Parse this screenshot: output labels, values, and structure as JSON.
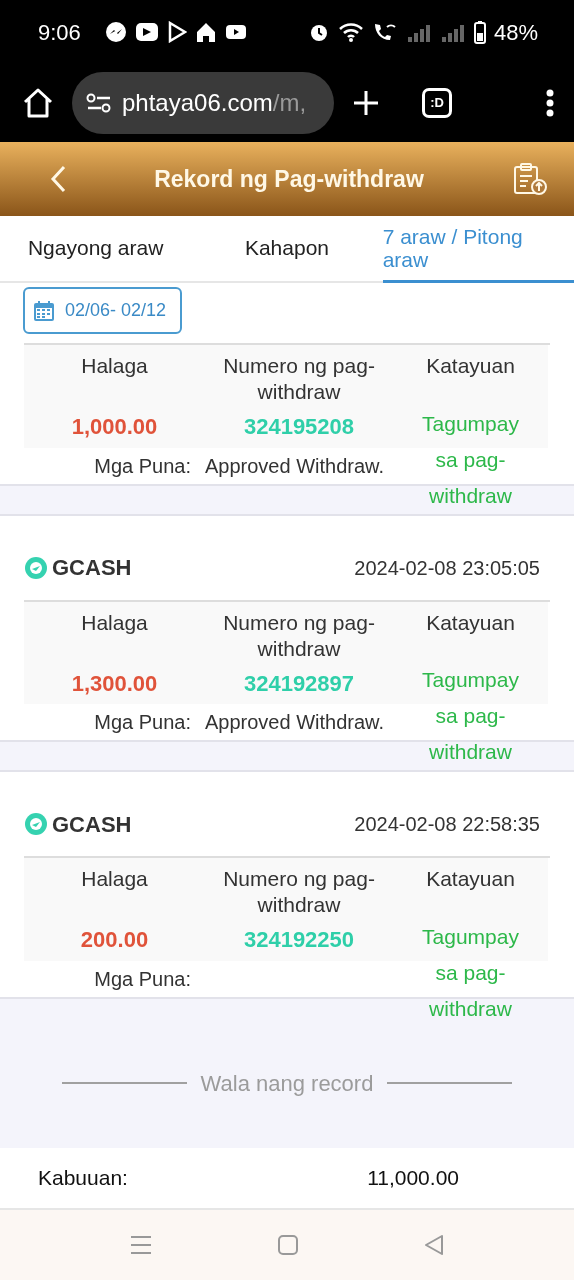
{
  "status_bar": {
    "time": "9:06",
    "battery": "48%"
  },
  "browser": {
    "url_host": "phtaya06.com",
    "url_path": "/m,",
    "tab_label": ":D"
  },
  "header": {
    "title": "Rekord ng Pag-withdraw"
  },
  "tabs": [
    {
      "label": "Ngayong araw",
      "selected": false
    },
    {
      "label": "Kahapon",
      "selected": false
    },
    {
      "label": "7 araw / Pitong araw",
      "selected": true
    }
  ],
  "date_range": "02/06- 02/12",
  "records": [
    {
      "columns": [
        "Halaga",
        "Numero ng pag-withdraw",
        "Katayuan"
      ],
      "amount": "1,000.00",
      "number": "324195208",
      "status": "Tagumpay sa pag-withdraw",
      "remarks_label": "Mga Puna:",
      "remarks": "Approved Withdraw."
    },
    {
      "provider": "GCASH",
      "time": "2024-02-08 23:05:05",
      "columns": [
        "Halaga",
        "Numero ng pag-withdraw",
        "Katayuan"
      ],
      "amount": "1,300.00",
      "number": "324192897",
      "status": "Tagumpay sa pag-withdraw",
      "remarks_label": "Mga Puna:",
      "remarks": "Approved Withdraw."
    },
    {
      "provider": "GCASH",
      "time": "2024-02-08 22:58:35",
      "columns": [
        "Halaga",
        "Numero ng pag-withdraw",
        "Katayuan"
      ],
      "amount": "200.00",
      "number": "324192250",
      "status": "Tagumpay sa pag-withdraw",
      "remarks_label": "Mga Puna:"
    }
  ],
  "end_text": "Wala nang record",
  "total": {
    "label": "Kabuuan:",
    "value": "11,000.00"
  }
}
